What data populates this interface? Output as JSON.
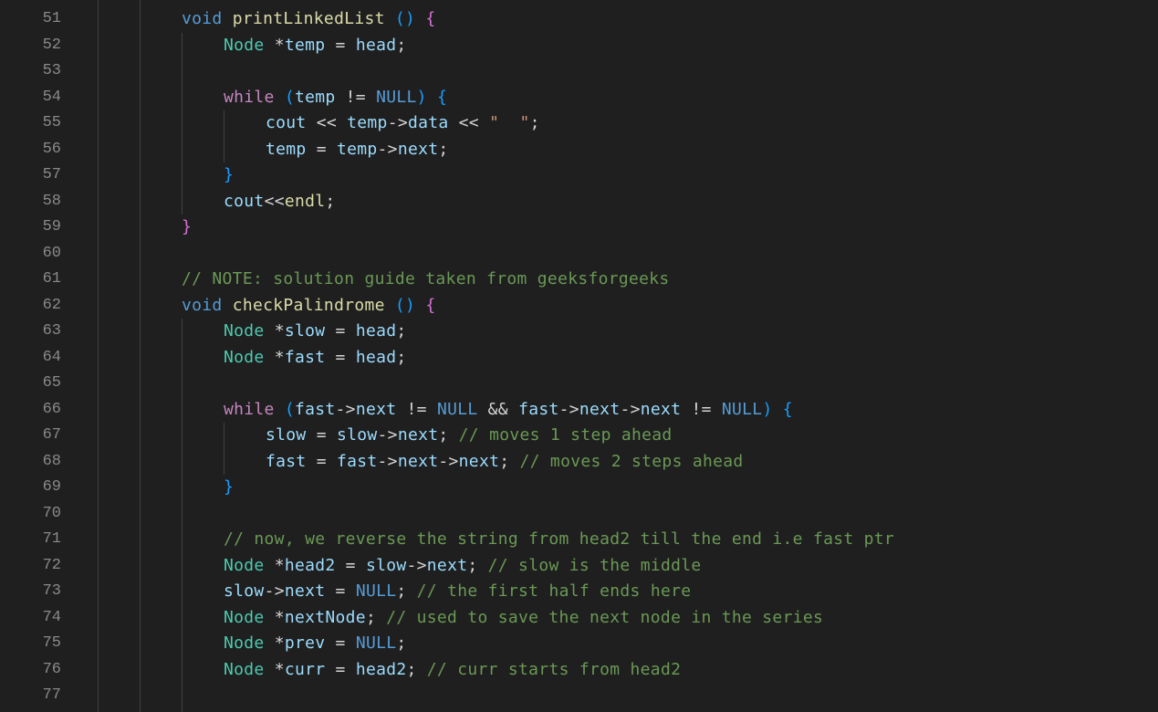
{
  "editor": {
    "line_numbers": [
      "51",
      "52",
      "53",
      "54",
      "55",
      "56",
      "57",
      "58",
      "59",
      "60",
      "61",
      "62",
      "63",
      "64",
      "65",
      "66",
      "67",
      "68",
      "69",
      "70",
      "71",
      "72",
      "73",
      "74",
      "75",
      "76",
      "77"
    ],
    "lines": [
      [
        {
          "t": "void",
          "c": "kw"
        },
        {
          "t": " ",
          "c": "p"
        },
        {
          "t": "printLinkedList",
          "c": "fn"
        },
        {
          "t": " ",
          "c": "p"
        },
        {
          "t": "()",
          "c": "b2"
        },
        {
          "t": " ",
          "c": "p"
        },
        {
          "t": "{",
          "c": "b1"
        }
      ],
      [
        {
          "t": "Node",
          "c": "type"
        },
        {
          "t": " *",
          "c": "op"
        },
        {
          "t": "temp",
          "c": "var"
        },
        {
          "t": " = ",
          "c": "op"
        },
        {
          "t": "head",
          "c": "var"
        },
        {
          "t": ";",
          "c": "p"
        }
      ],
      [],
      [
        {
          "t": "while",
          "c": "ctl"
        },
        {
          "t": " ",
          "c": "p"
        },
        {
          "t": "(",
          "c": "b2"
        },
        {
          "t": "temp",
          "c": "var"
        },
        {
          "t": " != ",
          "c": "op"
        },
        {
          "t": "NULL",
          "c": "null"
        },
        {
          "t": ")",
          "c": "b2"
        },
        {
          "t": " ",
          "c": "p"
        },
        {
          "t": "{",
          "c": "b2"
        }
      ],
      [
        {
          "t": "cout",
          "c": "var"
        },
        {
          "t": " << ",
          "c": "op"
        },
        {
          "t": "temp",
          "c": "var"
        },
        {
          "t": "->",
          "c": "op"
        },
        {
          "t": "data",
          "c": "var"
        },
        {
          "t": " << ",
          "c": "op"
        },
        {
          "t": "\"  \"",
          "c": "str"
        },
        {
          "t": ";",
          "c": "p"
        }
      ],
      [
        {
          "t": "temp",
          "c": "var"
        },
        {
          "t": " = ",
          "c": "op"
        },
        {
          "t": "temp",
          "c": "var"
        },
        {
          "t": "->",
          "c": "op"
        },
        {
          "t": "next",
          "c": "var"
        },
        {
          "t": ";",
          "c": "p"
        }
      ],
      [
        {
          "t": "}",
          "c": "b2"
        }
      ],
      [
        {
          "t": "cout",
          "c": "var"
        },
        {
          "t": "<<",
          "c": "op"
        },
        {
          "t": "endl",
          "c": "fn"
        },
        {
          "t": ";",
          "c": "p"
        }
      ],
      [
        {
          "t": "}",
          "c": "b1"
        }
      ],
      [],
      [
        {
          "t": "// NOTE: solution guide taken from geeksforgeeks",
          "c": "cmt"
        }
      ],
      [
        {
          "t": "void",
          "c": "kw"
        },
        {
          "t": " ",
          "c": "p"
        },
        {
          "t": "checkPalindrome",
          "c": "fn"
        },
        {
          "t": " ",
          "c": "p"
        },
        {
          "t": "()",
          "c": "b2"
        },
        {
          "t": " ",
          "c": "p"
        },
        {
          "t": "{",
          "c": "b1"
        }
      ],
      [
        {
          "t": "Node",
          "c": "type"
        },
        {
          "t": " *",
          "c": "op"
        },
        {
          "t": "slow",
          "c": "var"
        },
        {
          "t": " = ",
          "c": "op"
        },
        {
          "t": "head",
          "c": "var"
        },
        {
          "t": ";",
          "c": "p"
        }
      ],
      [
        {
          "t": "Node",
          "c": "type"
        },
        {
          "t": " *",
          "c": "op"
        },
        {
          "t": "fast",
          "c": "var"
        },
        {
          "t": " = ",
          "c": "op"
        },
        {
          "t": "head",
          "c": "var"
        },
        {
          "t": ";",
          "c": "p"
        }
      ],
      [],
      [
        {
          "t": "while",
          "c": "ctl"
        },
        {
          "t": " ",
          "c": "p"
        },
        {
          "t": "(",
          "c": "b2"
        },
        {
          "t": "fast",
          "c": "var"
        },
        {
          "t": "->",
          "c": "op"
        },
        {
          "t": "next",
          "c": "var"
        },
        {
          "t": " != ",
          "c": "op"
        },
        {
          "t": "NULL",
          "c": "null"
        },
        {
          "t": " && ",
          "c": "op"
        },
        {
          "t": "fast",
          "c": "var"
        },
        {
          "t": "->",
          "c": "op"
        },
        {
          "t": "next",
          "c": "var"
        },
        {
          "t": "->",
          "c": "op"
        },
        {
          "t": "next",
          "c": "var"
        },
        {
          "t": " != ",
          "c": "op"
        },
        {
          "t": "NULL",
          "c": "null"
        },
        {
          "t": ")",
          "c": "b2"
        },
        {
          "t": " ",
          "c": "p"
        },
        {
          "t": "{",
          "c": "b2"
        }
      ],
      [
        {
          "t": "slow",
          "c": "var"
        },
        {
          "t": " = ",
          "c": "op"
        },
        {
          "t": "slow",
          "c": "var"
        },
        {
          "t": "->",
          "c": "op"
        },
        {
          "t": "next",
          "c": "var"
        },
        {
          "t": "; ",
          "c": "p"
        },
        {
          "t": "// moves 1 step ahead",
          "c": "cmt"
        }
      ],
      [
        {
          "t": "fast",
          "c": "var"
        },
        {
          "t": " = ",
          "c": "op"
        },
        {
          "t": "fast",
          "c": "var"
        },
        {
          "t": "->",
          "c": "op"
        },
        {
          "t": "next",
          "c": "var"
        },
        {
          "t": "->",
          "c": "op"
        },
        {
          "t": "next",
          "c": "var"
        },
        {
          "t": "; ",
          "c": "p"
        },
        {
          "t": "// moves 2 steps ahead",
          "c": "cmt"
        }
      ],
      [
        {
          "t": "}",
          "c": "b2"
        }
      ],
      [],
      [
        {
          "t": "// now, we reverse the string from head2 till the end i.e fast ptr",
          "c": "cmt"
        }
      ],
      [
        {
          "t": "Node",
          "c": "type"
        },
        {
          "t": " *",
          "c": "op"
        },
        {
          "t": "head2",
          "c": "var"
        },
        {
          "t": " = ",
          "c": "op"
        },
        {
          "t": "slow",
          "c": "var"
        },
        {
          "t": "->",
          "c": "op"
        },
        {
          "t": "next",
          "c": "var"
        },
        {
          "t": "; ",
          "c": "p"
        },
        {
          "t": "// slow is the middle",
          "c": "cmt"
        }
      ],
      [
        {
          "t": "slow",
          "c": "var"
        },
        {
          "t": "->",
          "c": "op"
        },
        {
          "t": "next",
          "c": "var"
        },
        {
          "t": " = ",
          "c": "op"
        },
        {
          "t": "NULL",
          "c": "null"
        },
        {
          "t": "; ",
          "c": "p"
        },
        {
          "t": "// the first half ends here",
          "c": "cmt"
        }
      ],
      [
        {
          "t": "Node",
          "c": "type"
        },
        {
          "t": " *",
          "c": "op"
        },
        {
          "t": "nextNode",
          "c": "var"
        },
        {
          "t": "; ",
          "c": "p"
        },
        {
          "t": "// used to save the next node in the series",
          "c": "cmt"
        }
      ],
      [
        {
          "t": "Node",
          "c": "type"
        },
        {
          "t": " *",
          "c": "op"
        },
        {
          "t": "prev",
          "c": "var"
        },
        {
          "t": " = ",
          "c": "op"
        },
        {
          "t": "NULL",
          "c": "null"
        },
        {
          "t": ";",
          "c": "p"
        }
      ],
      [
        {
          "t": "Node",
          "c": "type"
        },
        {
          "t": " *",
          "c": "op"
        },
        {
          "t": "curr",
          "c": "var"
        },
        {
          "t": " = ",
          "c": "op"
        },
        {
          "t": "head2",
          "c": "var"
        },
        {
          "t": "; ",
          "c": "p"
        },
        {
          "t": "// curr starts from head2",
          "c": "cmt"
        }
      ],
      []
    ],
    "indent_levels": [
      2,
      3,
      3,
      3,
      4,
      4,
      3,
      3,
      2,
      2,
      2,
      2,
      3,
      3,
      3,
      3,
      4,
      4,
      3,
      3,
      3,
      3,
      3,
      3,
      3,
      3,
      3
    ],
    "colors": {
      "background": "#1f1f1f",
      "line_number": "#8a8a8a",
      "keyword": "#569cd6",
      "control": "#c586c0",
      "type": "#4ec9b0",
      "function": "#dcdcaa",
      "variable": "#9cdcfe",
      "comment": "#6a9955",
      "string": "#ce9178"
    }
  }
}
